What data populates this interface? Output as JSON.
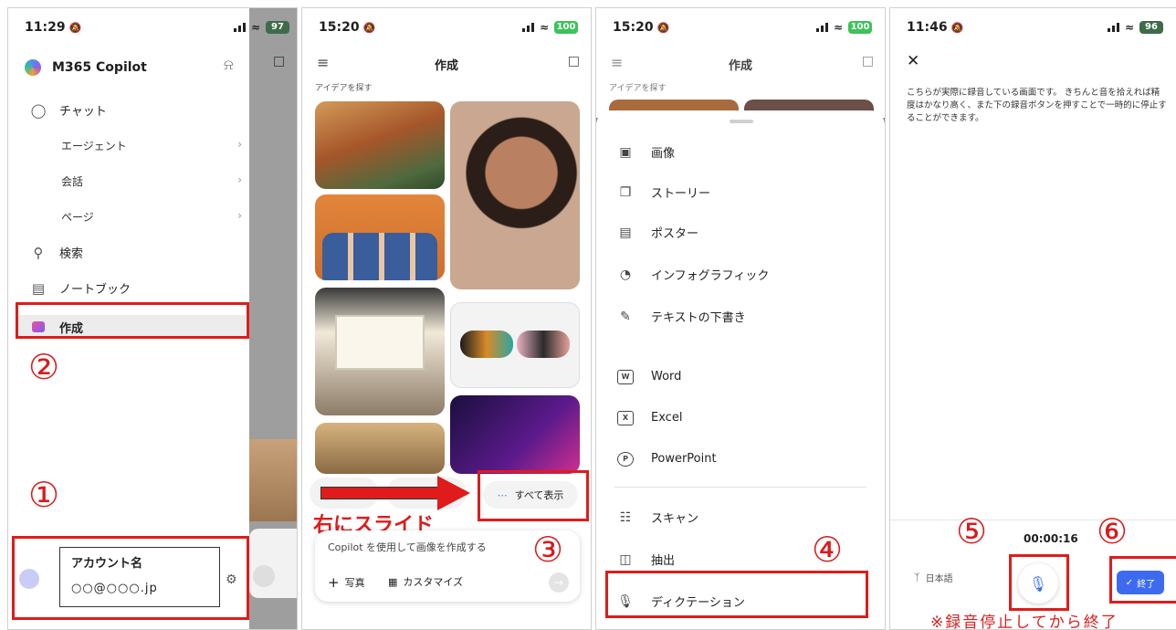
{
  "panel1": {
    "time": "11:29",
    "battery": "97",
    "app_title": "M365 Copilot",
    "nav": [
      {
        "label": "チャット",
        "icon": "chat-bubble-icon"
      },
      {
        "label": "検索",
        "icon": "search-icon"
      },
      {
        "label": "ノートブック",
        "icon": "notebook-icon"
      },
      {
        "label": "作成",
        "icon": "create-icon"
      }
    ],
    "chat_sub": [
      {
        "label": "エージェント"
      },
      {
        "label": "会話"
      },
      {
        "label": "ページ"
      }
    ],
    "chevron": "›",
    "account_name": "アカウント名",
    "account_email": "○○@○○○.jp",
    "step1": "①",
    "step2": "②"
  },
  "panel2": {
    "time": "15:20",
    "battery": "100",
    "title": "作成",
    "section": "アイデアを探す",
    "show_all": "すべて表示",
    "slide_hint": "右にスライド",
    "prompt_placeholder": "Copilot を使用して画像を作成する",
    "photo_label": "写真",
    "customize_label": "カスタマイズ",
    "step3": "③"
  },
  "panel3": {
    "time": "15:20",
    "battery": "100",
    "title": "作成",
    "section": "アイデアを探す",
    "menu": [
      {
        "label": "画像",
        "icon": "image-icon"
      },
      {
        "label": "ストーリー",
        "icon": "story-icon"
      },
      {
        "label": "ポスター",
        "icon": "poster-icon"
      },
      {
        "label": "インフォグラフィック",
        "icon": "infographic-icon"
      },
      {
        "label": "テキストの下書き",
        "icon": "text-draft-icon"
      }
    ],
    "apps": [
      {
        "label": "Word",
        "icon": "word-icon"
      },
      {
        "label": "Excel",
        "icon": "excel-icon"
      },
      {
        "label": "PowerPoint",
        "icon": "powerpoint-icon"
      }
    ],
    "tools": [
      {
        "label": "スキャン",
        "icon": "scan-icon"
      },
      {
        "label": "抽出",
        "icon": "extract-icon"
      },
      {
        "label": "ディクテーション",
        "icon": "microphone-icon"
      }
    ],
    "step4": "④"
  },
  "panel4": {
    "time": "11:46",
    "battery": "96",
    "transcript": "こちらが実際に録音している画面です。 きちんと音を拾えれば精度はかなり高く、また下の録音ボタンを押すことで一時的に停止することができます。",
    "timer": "00:00:16",
    "language": "日本語",
    "finish": "終了",
    "note": "※録音停止してから終了",
    "step5": "⑤",
    "step6": "⑥"
  },
  "colors": {
    "accent_red": "#e01b1b",
    "primary_blue": "#3d6bf0",
    "battery_green": "#3cc35a"
  }
}
